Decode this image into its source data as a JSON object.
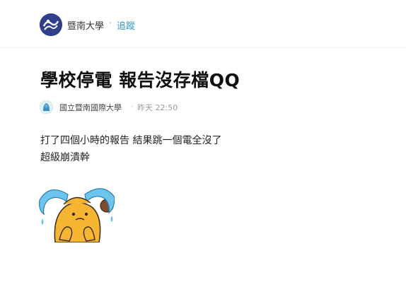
{
  "header": {
    "board_name": "暨南大學",
    "separator": "·",
    "follow_label": "追蹤",
    "board_icon": "ncnu-logo-icon"
  },
  "post": {
    "title": "學校停電 報告沒存檔QQ",
    "author": "國立暨南國際大學",
    "time_separator": "·",
    "time": "昨天 22:50",
    "avatar_icon": "user-avatar-icon",
    "body_lines": [
      "打了四個小時的報告 結果跳一個電全沒了",
      "超級崩潰幹"
    ],
    "sticker_icon": "crying-bear-sticker-icon"
  },
  "colors": {
    "accent_link": "#3397cf",
    "board_logo_bg": "#2f3f8a",
    "sticker_yellow": "#f6b632",
    "tears_blue": "#6cc5ec"
  }
}
